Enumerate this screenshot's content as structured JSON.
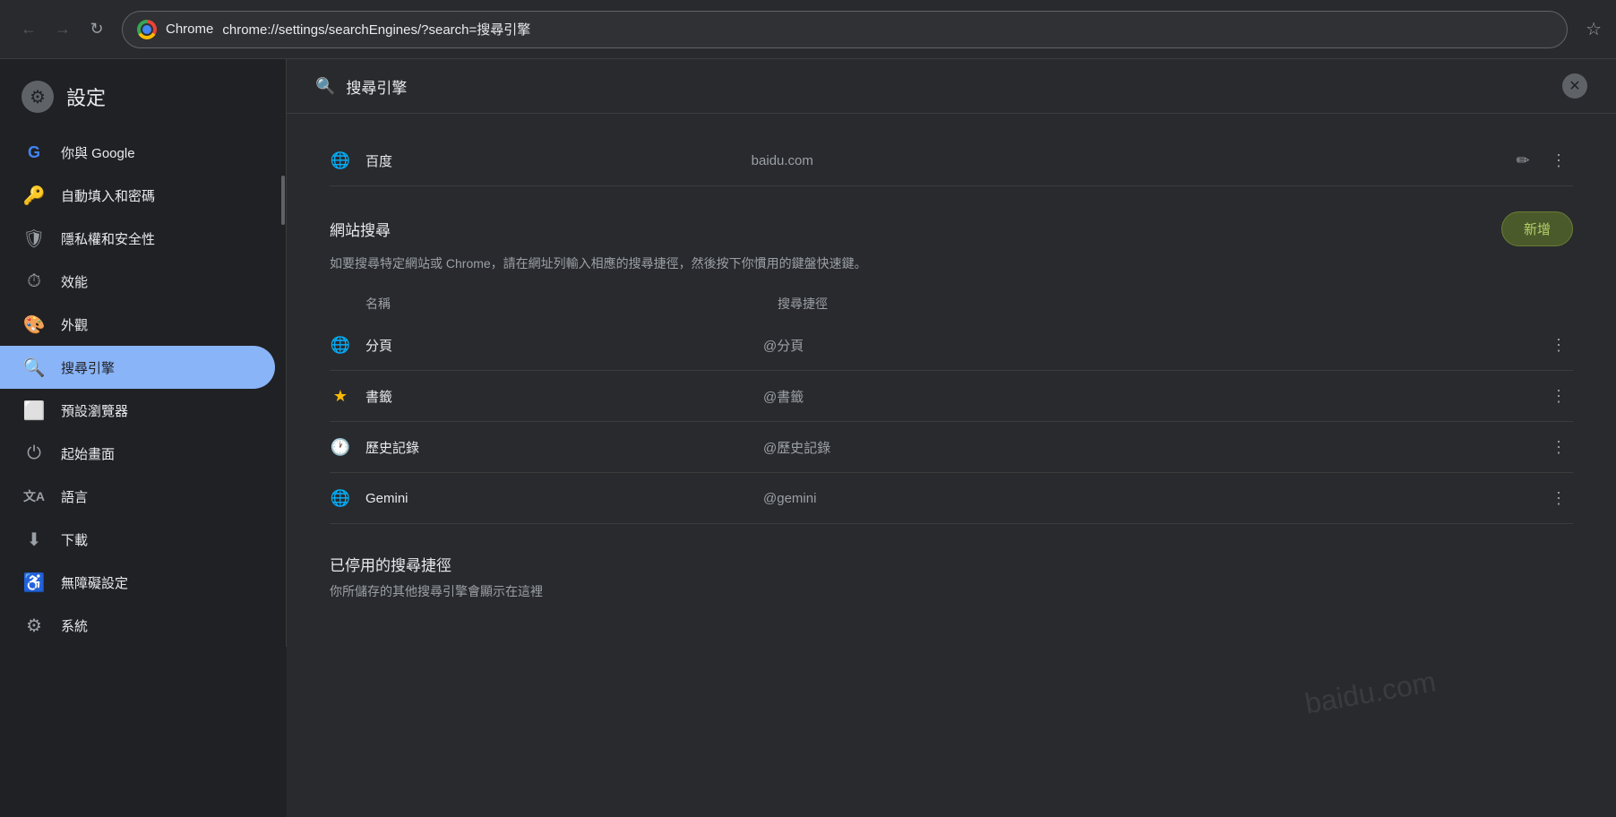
{
  "browser": {
    "app_name": "Chrome",
    "url": "chrome://settings/searchEngines/?search=搜尋引擎",
    "back_label": "←",
    "forward_label": "→",
    "refresh_label": "↻"
  },
  "settings": {
    "title": "設定",
    "search_placeholder": "搜尋引擎",
    "search_value": "搜尋引擎"
  },
  "sidebar": {
    "items": [
      {
        "id": "google",
        "label": "你與 Google",
        "icon": "G"
      },
      {
        "id": "autofill",
        "label": "自動填入和密碼",
        "icon": "🔑"
      },
      {
        "id": "privacy",
        "label": "隱私權和安全性",
        "icon": "🛡"
      },
      {
        "id": "performance",
        "label": "效能",
        "icon": "⏱"
      },
      {
        "id": "appearance",
        "label": "外觀",
        "icon": "🎨"
      },
      {
        "id": "search",
        "label": "搜尋引擎",
        "icon": "🔍",
        "active": true
      },
      {
        "id": "browser",
        "label": "預設瀏覽器",
        "icon": "⬜"
      },
      {
        "id": "startup",
        "label": "起始畫面",
        "icon": "⏻"
      },
      {
        "id": "language",
        "label": "語言",
        "icon": "文A"
      },
      {
        "id": "downloads",
        "label": "下載",
        "icon": "⬇"
      },
      {
        "id": "accessibility",
        "label": "無障礙設定",
        "icon": "♿"
      },
      {
        "id": "system",
        "label": "系統",
        "icon": "⚙"
      }
    ]
  },
  "main": {
    "default_search_engines": {
      "baidu": {
        "name": "百度",
        "url": "baidu.com"
      }
    },
    "site_search": {
      "section_title": "網站搜尋",
      "add_button_label": "新增",
      "description": "如要搜尋特定網站或 Chrome，請在網址列輸入相應的搜尋捷徑，然後按下你慣用的鍵盤快速鍵。",
      "col_name": "名稱",
      "col_shortcut": "搜尋捷徑",
      "rows": [
        {
          "name": "分頁",
          "shortcut": "@分頁",
          "icon_type": "globe"
        },
        {
          "name": "書籤",
          "shortcut": "@書籤",
          "icon_type": "star"
        },
        {
          "name": "歷史記錄",
          "shortcut": "@歷史記錄",
          "icon_type": "history"
        },
        {
          "name": "Gemini",
          "shortcut": "@gemini",
          "icon_type": "globe"
        }
      ]
    },
    "disabled_section": {
      "title": "已停用的搜尋捷徑",
      "description": "你所儲存的其他搜尋引擎會顯示在這裡"
    }
  }
}
